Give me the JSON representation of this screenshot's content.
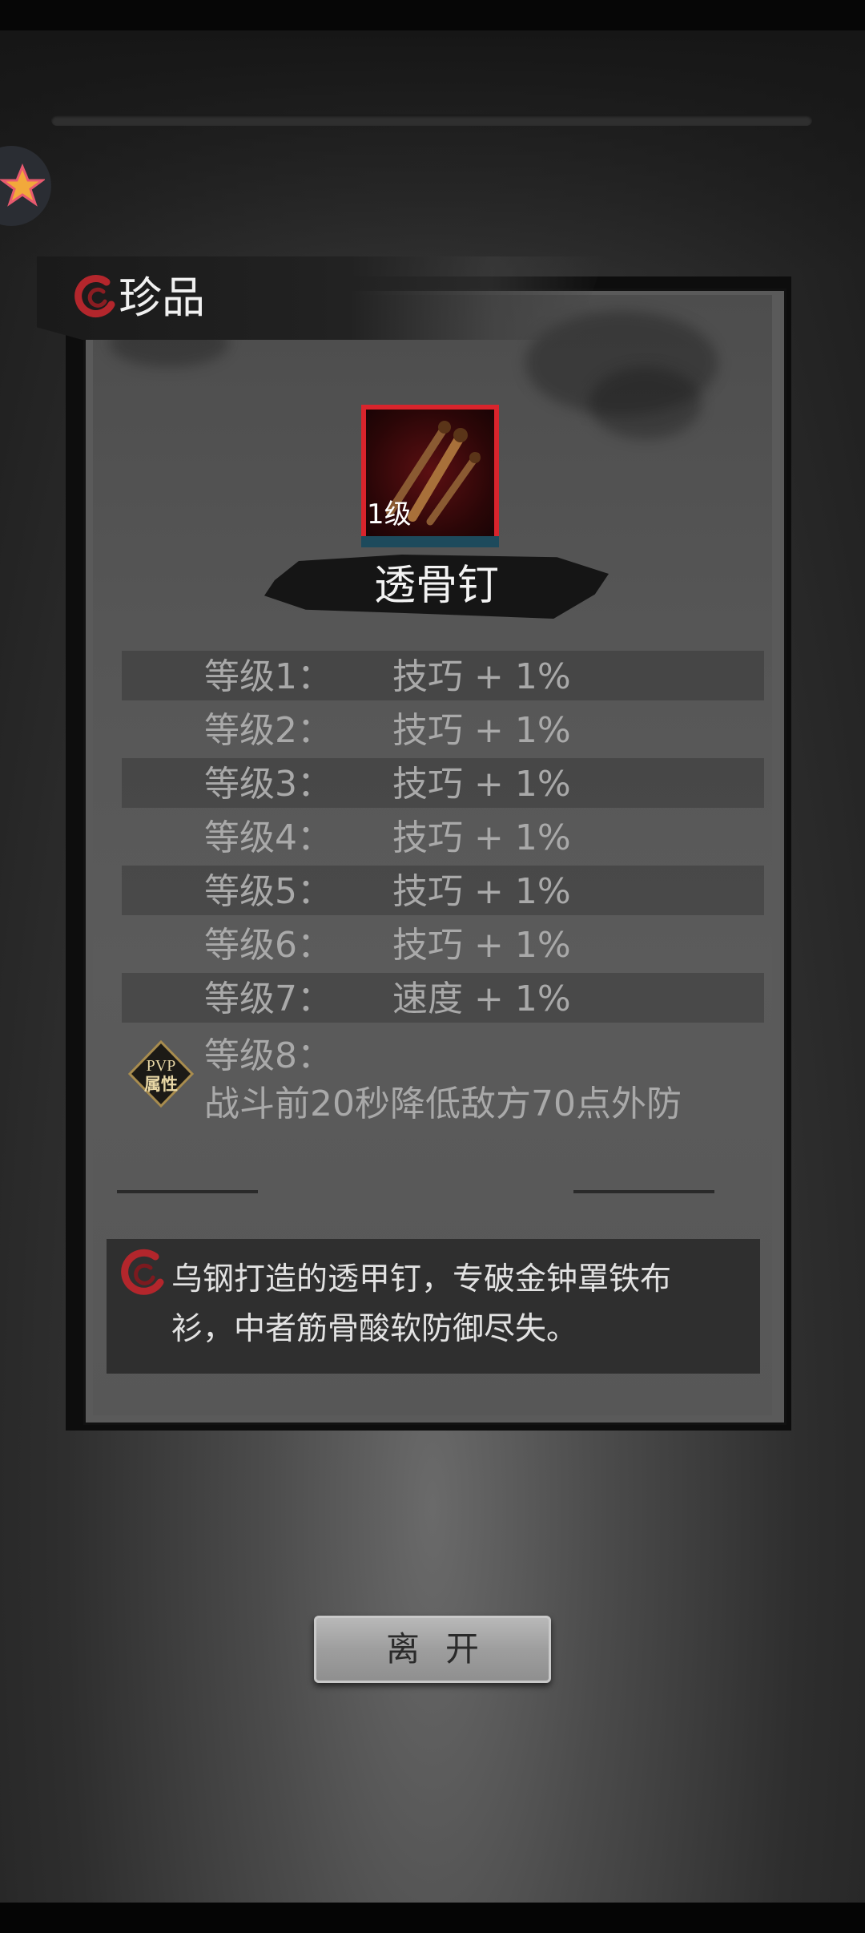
{
  "dialog": {
    "title": "珍品",
    "item": {
      "level_badge": "1级",
      "name": "透骨钉"
    },
    "stats": [
      {
        "level": "等级1：",
        "value": "技巧 + 1%"
      },
      {
        "level": "等级2：",
        "value": "技巧 + 1%"
      },
      {
        "level": "等级3：",
        "value": "技巧 + 1%"
      },
      {
        "level": "等级4：",
        "value": "技巧 + 1%"
      },
      {
        "level": "等级5：",
        "value": "技巧 + 1%"
      },
      {
        "level": "等级6：",
        "value": "技巧 + 1%"
      },
      {
        "level": "等级7：",
        "value": "速度 + 1%"
      }
    ],
    "pvp": {
      "badge_line1": "PVP",
      "badge_line2": "属性",
      "level": "等级8：",
      "description": "战斗前20秒降低敌方70点外防"
    },
    "description": "乌钢打造的透甲钉，专破金钟罩铁布\n衫，中者筋骨酸软防御尽失。",
    "leave_button": "离开"
  },
  "colors": {
    "frame_red": "#d9242c",
    "accent_red": "#b3262c"
  },
  "icons": {
    "floating": "star-icon",
    "title": "swirl-icon",
    "item": "bone-nail-icon",
    "description": "swirl-icon"
  }
}
